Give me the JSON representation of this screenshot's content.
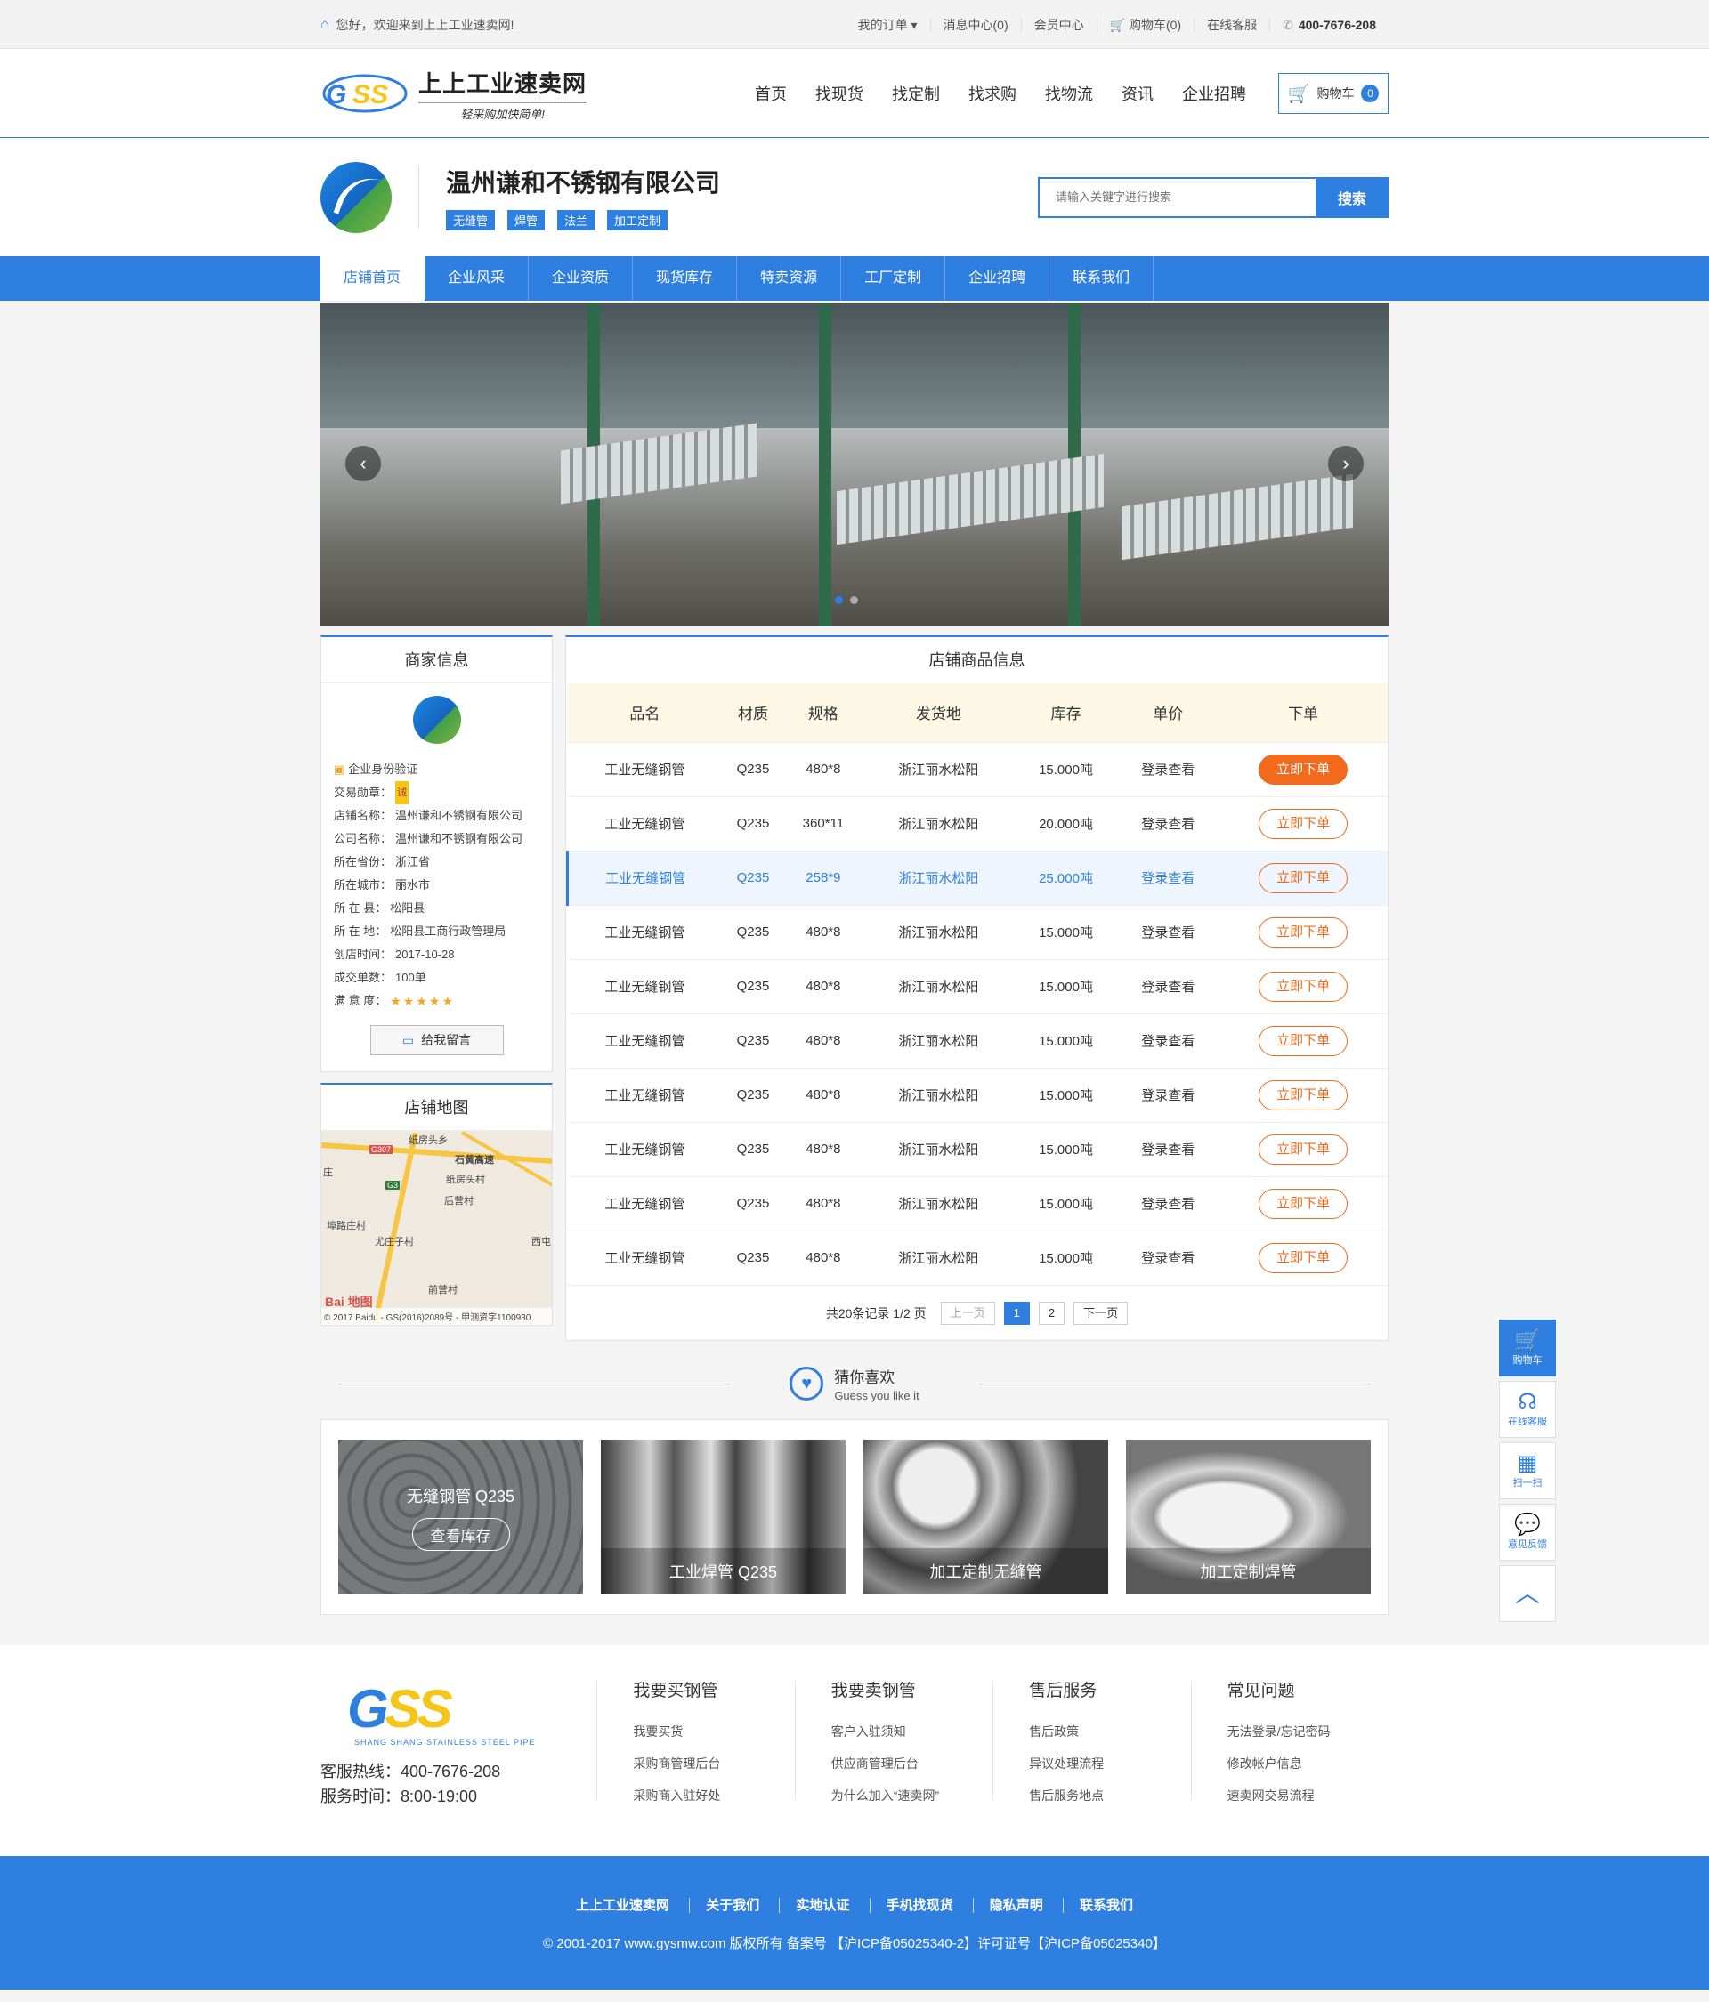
{
  "topbar": {
    "welcome": "您好，欢迎来到上上工业速卖网!",
    "links": [
      "我的订单 ▾",
      "消息中心(0)",
      "会员中心",
      "购物车(0)",
      "在线客服"
    ],
    "phone": "400-7676-208"
  },
  "header": {
    "brand": "上上工业速卖网",
    "slogan": "轻采购加快简单!",
    "nav": [
      "首页",
      "找现货",
      "找定制",
      "找求购",
      "找物流",
      "资讯",
      "企业招聘"
    ],
    "cart_label": "购物车",
    "cart_count": "0"
  },
  "shop": {
    "name": "温州谦和不锈钢有限公司",
    "tags": [
      "无缝管",
      "焊管",
      "法兰",
      "加工定制"
    ],
    "search_placeholder": "请输入关键字进行搜索",
    "search_button": "搜索",
    "nav": [
      "店铺首页",
      "企业风采",
      "企业资质",
      "现货库存",
      "特卖资源",
      "工厂定制",
      "企业招聘",
      "联系我们"
    ]
  },
  "merchant": {
    "title": "商家信息",
    "verify": "企业身份验证",
    "rows": [
      {
        "label": "交易勋章：",
        "value": "诚"
      },
      {
        "label": "店铺名称：",
        "value": "温州谦和不锈钢有限公司"
      },
      {
        "label": "公司名称：",
        "value": "温州谦和不锈钢有限公司"
      },
      {
        "label": "所在省份：",
        "value": "浙江省"
      },
      {
        "label": "所在城市：",
        "value": "丽水市"
      },
      {
        "label": "所 在 县：",
        "value": "松阳县"
      },
      {
        "label": "所 在 地：",
        "value": "松阳县工商行政管理局"
      },
      {
        "label": "创店时间：",
        "value": "2017-10-28"
      },
      {
        "label": "成交单数：",
        "value": "100单"
      },
      {
        "label": "满 意 度：",
        "value": "★★★★★"
      }
    ],
    "message_button": "给我留言"
  },
  "map": {
    "title": "店铺地图",
    "labels": [
      "纸房头乡",
      "石黄高速",
      "纸房头村",
      "后营村",
      "埠路庄村",
      "尤庄子村",
      "西屯",
      "前营村",
      "G307",
      "G3",
      "庄"
    ],
    "copyright": "© 2017 Baidu - GS(2016)2089号 - 甲测资字1100930",
    "baidu": "Bai 地图"
  },
  "products": {
    "title": "店铺商品信息",
    "headers": [
      "品名",
      "材质",
      "规格",
      "发货地",
      "库存",
      "单价",
      "下单"
    ],
    "rows": [
      [
        "工业无缝钢管",
        "Q235",
        "480*8",
        "浙江丽水松阳",
        "15.000吨",
        "登录查看",
        "立即下单"
      ],
      [
        "工业无缝钢管",
        "Q235",
        "360*11",
        "浙江丽水松阳",
        "20.000吨",
        "登录查看",
        "立即下单"
      ],
      [
        "工业无缝钢管",
        "Q235",
        "258*9",
        "浙江丽水松阳",
        "25.000吨",
        "登录查看",
        "立即下单"
      ],
      [
        "工业无缝钢管",
        "Q235",
        "480*8",
        "浙江丽水松阳",
        "15.000吨",
        "登录查看",
        "立即下单"
      ],
      [
        "工业无缝钢管",
        "Q235",
        "480*8",
        "浙江丽水松阳",
        "15.000吨",
        "登录查看",
        "立即下单"
      ],
      [
        "工业无缝钢管",
        "Q235",
        "480*8",
        "浙江丽水松阳",
        "15.000吨",
        "登录查看",
        "立即下单"
      ],
      [
        "工业无缝钢管",
        "Q235",
        "480*8",
        "浙江丽水松阳",
        "15.000吨",
        "登录查看",
        "立即下单"
      ],
      [
        "工业无缝钢管",
        "Q235",
        "480*8",
        "浙江丽水松阳",
        "15.000吨",
        "登录查看",
        "立即下单"
      ],
      [
        "工业无缝钢管",
        "Q235",
        "480*8",
        "浙江丽水松阳",
        "15.000吨",
        "登录查看",
        "立即下单"
      ],
      [
        "工业无缝钢管",
        "Q235",
        "480*8",
        "浙江丽水松阳",
        "15.000吨",
        "登录查看",
        "立即下单"
      ]
    ],
    "pager": {
      "summary": "共20条记录  1/2 页",
      "prev": "上一页",
      "pages": [
        "1",
        "2"
      ],
      "next": "下一页"
    }
  },
  "guess": {
    "title": "猜你喜欢",
    "subtitle": "Guess you like it",
    "items": [
      {
        "name": "无缝钢管  Q235",
        "button": "查看库存"
      },
      {
        "name": "工业焊管  Q235"
      },
      {
        "name": "加工定制无缝管"
      },
      {
        "name": "加工定制焊管"
      }
    ]
  },
  "footer": {
    "logo_sub": "SHANG SHANG STAINLESS STEEL PIPE",
    "hotline": "客服热线：400-7676-208",
    "hours": "服务时间：8:00-19:00",
    "columns": [
      {
        "title": "我要买钢管",
        "items": [
          "我要买货",
          "采购商管理后台",
          "采购商入驻好处"
        ]
      },
      {
        "title": "我要卖钢管",
        "items": [
          "客户入驻须知",
          "供应商管理后台",
          "为什么加入“速卖网”"
        ]
      },
      {
        "title": "售后服务",
        "items": [
          "售后政策",
          "异议处理流程",
          "售后服务地点"
        ]
      },
      {
        "title": "常见问题",
        "items": [
          "无法登录/忘记密码",
          "修改帐户信息",
          "速卖网交易流程"
        ]
      }
    ],
    "bottom_links": [
      "上上工业速卖网",
      "关于我们",
      "实地认证",
      "手机找现货",
      "隐私声明",
      "联系我们"
    ],
    "copyright": "© 2001-2017  www.gysmw.com 版权所有  备案号 【沪ICP备05025340-2】许可证号【沪ICP备05025340】"
  },
  "side": [
    "购物车",
    "在线客服",
    "扫一扫",
    "意见反馈"
  ],
  "colors": {
    "primary": "#2f7fe0",
    "order": "#f26a1b",
    "header_bg": "#fdf8e6"
  }
}
